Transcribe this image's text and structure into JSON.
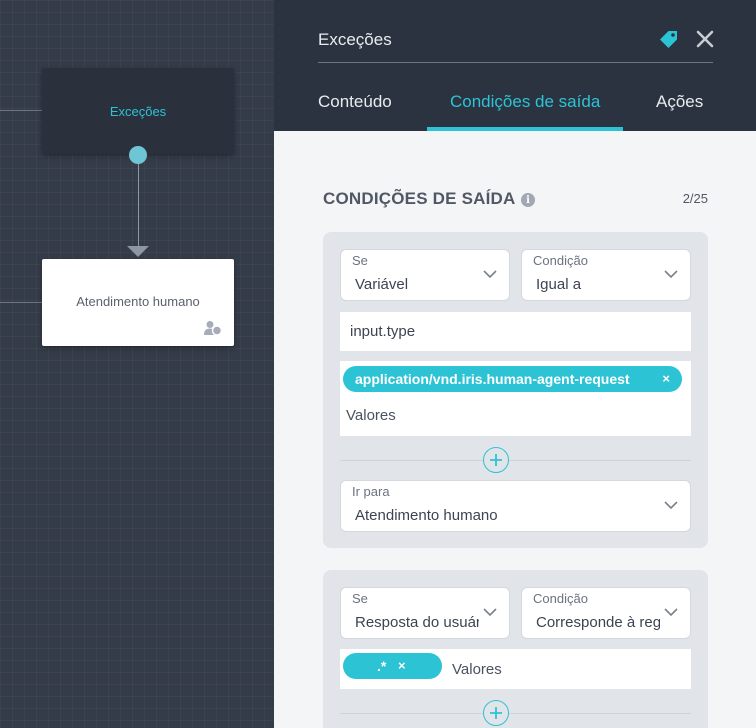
{
  "canvas": {
    "node_exceptions": {
      "title": "Exceções"
    },
    "node_human": {
      "title": "Atendimento humano"
    }
  },
  "panel": {
    "title": "Exceções",
    "tabs": [
      {
        "label": "Conteúdo",
        "active": false
      },
      {
        "label": "Condições de saída",
        "active": true
      },
      {
        "label": "Ações",
        "active": false
      }
    ],
    "section_title": "CONDIÇÕES DE SAÍDA",
    "counter": "2/25",
    "conditions": [
      {
        "if_label": "Se",
        "if_value": "Variável",
        "cond_label": "Condição",
        "cond_value": "Igual a",
        "variable": "input.type",
        "chip": "application/vnd.iris.human-agent-request",
        "values_placeholder": "Valores",
        "goto_label": "Ir para",
        "goto_value": "Atendimento humano"
      },
      {
        "if_label": "Se",
        "if_value": "Resposta do usuário",
        "cond_label": "Condição",
        "cond_value": "Corresponde à regex",
        "chip": ".*",
        "values_placeholder": "Valores"
      }
    ]
  },
  "icons": {
    "tag": "tag-icon",
    "close": "close-icon",
    "info": "info-icon",
    "chevron": "chevron-down-icon",
    "add": "plus-circle-icon",
    "user": "users-icon"
  },
  "colors": {
    "accent": "#2cc3d5",
    "panel_header": "#2b3340",
    "canvas_bg": "#353c49"
  }
}
